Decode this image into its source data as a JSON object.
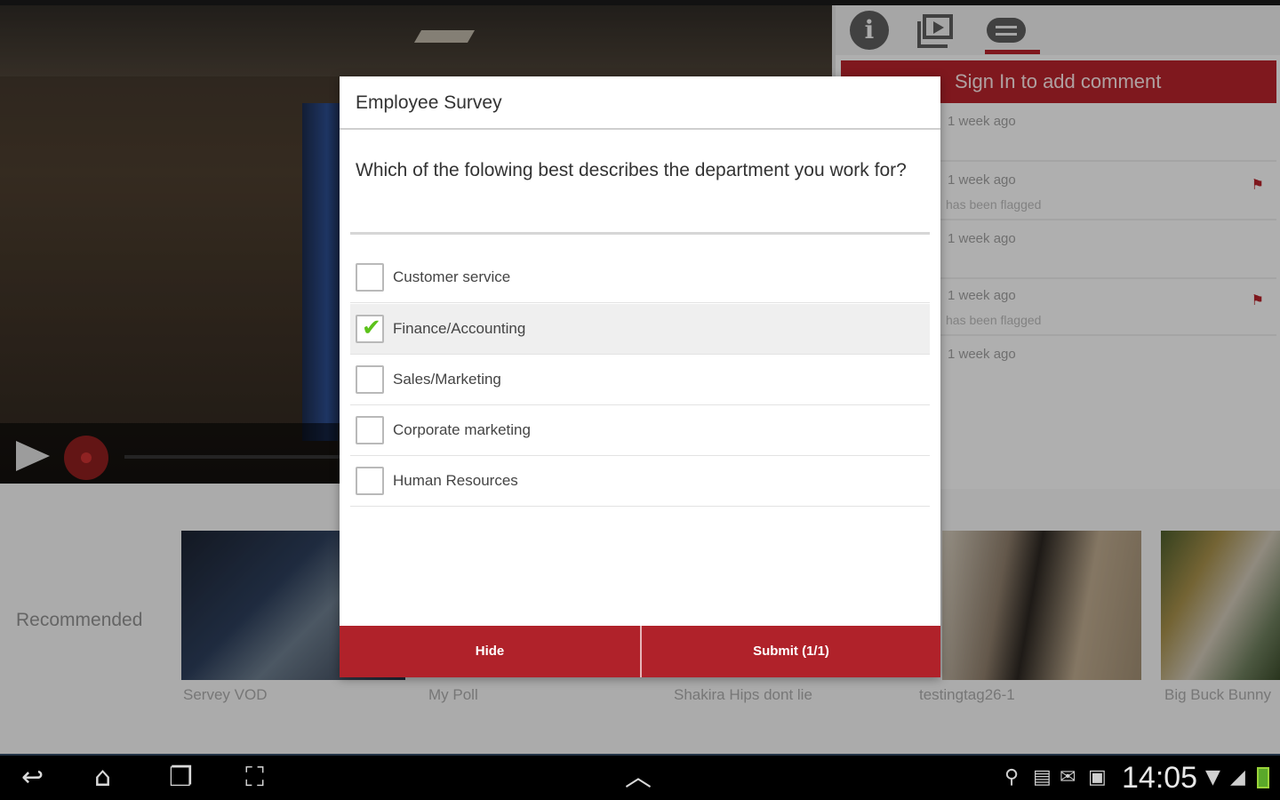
{
  "modal": {
    "title": "Employee Survey",
    "question": "Which of the folowing best describes the department you work for?",
    "options": [
      {
        "label": "Customer service",
        "checked": false
      },
      {
        "label": "Finance/Accounting",
        "checked": true
      },
      {
        "label": "Sales/Marketing",
        "checked": false
      },
      {
        "label": "Corporate marketing",
        "checked": false
      },
      {
        "label": "Human Resources",
        "checked": false
      }
    ],
    "hide_label": "Hide",
    "submit_label": "Submit (1/1)"
  },
  "side_panel": {
    "tabs": [
      "info-icon",
      "media-icon",
      "comments-icon"
    ],
    "active_tab": "comments",
    "sign_in_label": "Sign In to add comment",
    "comments": [
      {
        "time": "1 week ago",
        "note": "",
        "flagged": false
      },
      {
        "time": "1 week ago",
        "note": "has been flagged",
        "flagged": true
      },
      {
        "time": "1 week ago",
        "note": "",
        "flagged": false
      },
      {
        "time": "1 week ago",
        "note": "has been flagged",
        "flagged": true
      },
      {
        "time": "1 week ago",
        "note": "",
        "flagged": false
      }
    ]
  },
  "recommended": {
    "label": "Recommended",
    "items": [
      {
        "title": "Servey VOD"
      },
      {
        "title": "My Poll"
      },
      {
        "title": "Shakira Hips dont lie"
      },
      {
        "title": "testingtag26-1"
      },
      {
        "title": "Big Buck Bunny"
      }
    ]
  },
  "status_bar": {
    "time": "14:05"
  },
  "colors": {
    "accent": "#b0222a",
    "check": "#5cc21a"
  }
}
